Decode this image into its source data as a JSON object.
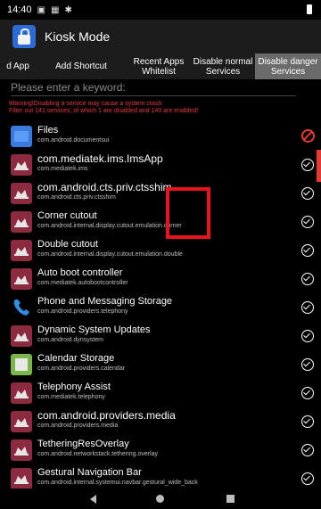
{
  "statusbar": {
    "time": "14:40"
  },
  "appbar": {
    "title": "Kiosk Mode"
  },
  "tabs": [
    {
      "label": "d App",
      "active": false
    },
    {
      "label": "Add Shortcut",
      "active": false
    },
    {
      "label": "Recent Apps\nWhitelist",
      "active": false
    },
    {
      "label": "Disable normal\nServices",
      "active": false
    },
    {
      "label": "Disable danger\nServices",
      "active": true
    }
  ],
  "search": {
    "placeholder": "Please enter a keyword:"
  },
  "warning": {
    "line1": "Warning!Disabling a service may cause a system crash",
    "line2": "Filter out 141 services, of which 1 are disabled and 140 are enabled!"
  },
  "rows": [
    {
      "name": "Files",
      "package": "com.android.documentsui",
      "icon": "folder-icon",
      "status": "disabled"
    },
    {
      "name": "com.mediatek.ims.ImsApp",
      "package": "com.mediatek.ims",
      "icon": "android-icon",
      "status": "enabled"
    },
    {
      "name": "com.android.cts.priv.ctsshim",
      "package": "com.android.cts.priv.ctsshim",
      "icon": "android-icon",
      "status": "enabled"
    },
    {
      "name": "Corner cutout",
      "package": "com.android.internal.display.cutout.emulation.corner",
      "icon": "android-icon",
      "status": "enabled"
    },
    {
      "name": "Double cutout",
      "package": "com.android.internal.display.cutout.emulation.double",
      "icon": "android-icon",
      "status": "enabled"
    },
    {
      "name": "Auto boot controller",
      "package": "com.mediatek.autobootcontroller",
      "icon": "android-icon",
      "status": "enabled"
    },
    {
      "name": "Phone and Messaging Storage",
      "package": "com.android.providers.telephony",
      "icon": "phone-icon",
      "status": "enabled"
    },
    {
      "name": "Dynamic System Updates",
      "package": "com.android.dynsystem",
      "icon": "android-icon",
      "status": "enabled"
    },
    {
      "name": "Calendar Storage",
      "package": "com.android.providers.calendar",
      "icon": "calendar-icon",
      "status": "enabled"
    },
    {
      "name": "Telephony Assist",
      "package": "com.mediatek.telephony",
      "icon": "android-icon",
      "status": "enabled"
    },
    {
      "name": "com.android.providers.media",
      "package": "com.android.providers.media",
      "icon": "android-icon",
      "status": "enabled"
    },
    {
      "name": "TetheringResOverlay",
      "package": "com.android.networkstack.tethering.overlay",
      "icon": "android-icon",
      "status": "enabled"
    },
    {
      "name": "Gestural Navigation Bar",
      "package": "com.android.internal.systemui.navbar.gestural_wide_back",
      "icon": "android-icon",
      "status": "enabled"
    }
  ],
  "colors": {
    "accent": "#e53935",
    "android_icon_bg": "#8c2a3f",
    "active_tab": "#6b6b6b",
    "highlight_box": "#e8131b"
  }
}
